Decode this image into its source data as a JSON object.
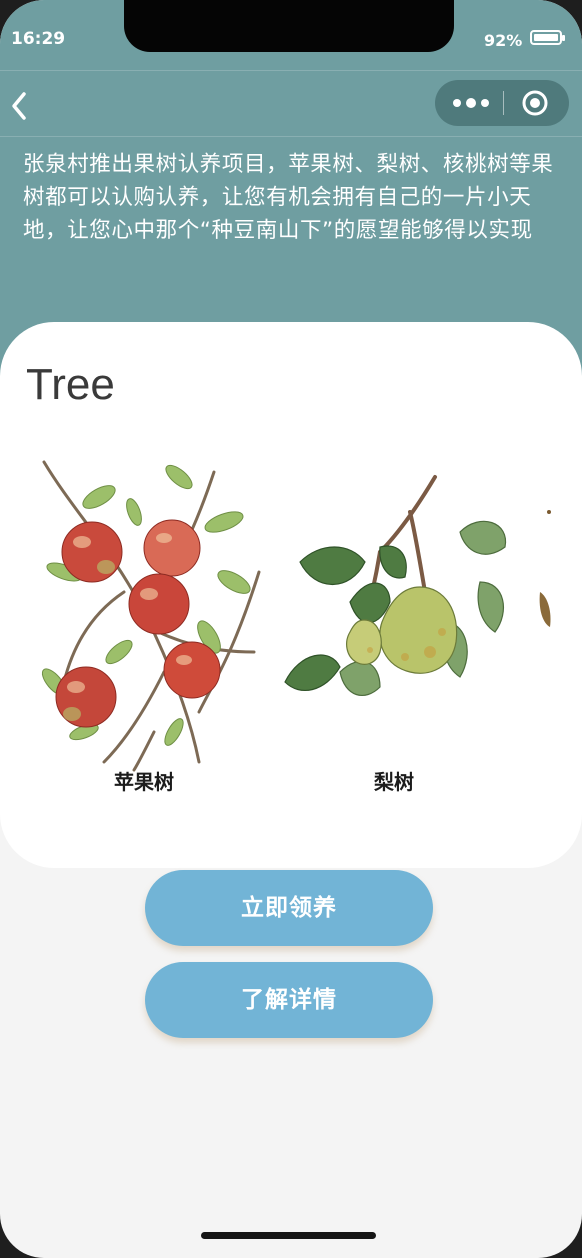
{
  "status_bar": {
    "time": "16:29",
    "battery": "92%"
  },
  "intro_text": "张泉村推出果树认养项目，苹果树、梨树、核桃树等果树都可以认购认养，让您有机会拥有自己的一片小天地，让您心中那个“种豆南山下”的愿望能够得以实现",
  "card": {
    "title": "Tree",
    "trees": [
      {
        "label": "苹果树",
        "icon": "apple-tree-illustration"
      },
      {
        "label": "梨树",
        "icon": "pear-tree-illustration"
      }
    ]
  },
  "buttons": {
    "adopt": "立即领养",
    "details": "了解详情"
  },
  "colors": {
    "header": "#6f9ea1",
    "button": "#72b4d6",
    "background": "#f4f4f4",
    "card": "#ffffff"
  }
}
